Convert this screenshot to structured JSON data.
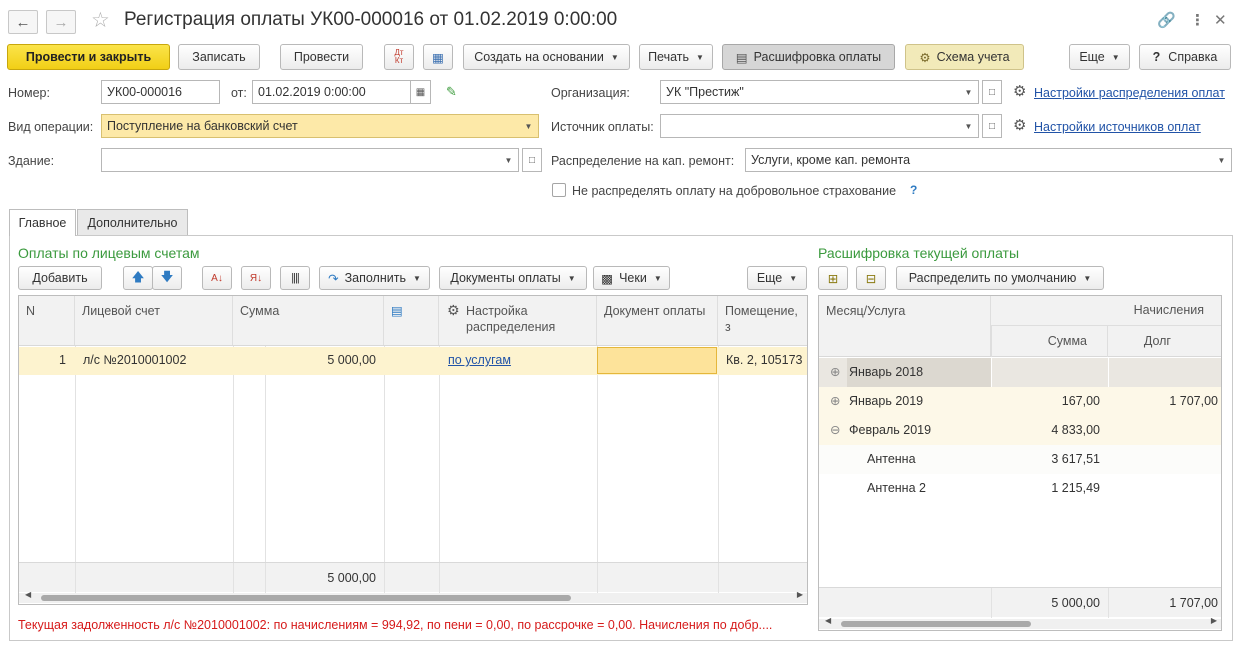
{
  "window": {
    "title": "Регистрация оплаты УК00-000016 от 01.02.2019 0:00:00"
  },
  "toolbar": {
    "post_close": "Провести и закрыть",
    "save": "Записать",
    "post": "Провести",
    "create_based": "Создать на основании",
    "print": "Печать",
    "payment_breakdown": "Расшифровка оплаты",
    "accounting_scheme": "Схема учета",
    "more": "Еще",
    "help": "Справка",
    "dt_kt": "Дт Кт"
  },
  "form": {
    "number_label": "Номер:",
    "number_value": "УК00-000016",
    "date_label": "от:",
    "date_value": "01.02.2019  0:00:00",
    "operation_label": "Вид операции:",
    "operation_value": "Поступление на банковский счет",
    "building_label": "Здание:",
    "building_value": "",
    "org_label": "Организация:",
    "org_value": "УК \"Престиж\"",
    "source_label": "Источник оплаты:",
    "source_value": "",
    "distribution_label": "Распределение на кап. ремонт:",
    "distribution_value": "Услуги, кроме кап. ремонта",
    "no_insurance_label": "Не распределять оплату на добровольное страхование",
    "no_insurance_checked": false,
    "link_distribution_settings": "Настройки распределения оплат",
    "link_source_settings": "Настройки источников оплат"
  },
  "tabs": [
    {
      "label": "Главное",
      "active": true
    },
    {
      "label": "Дополнительно",
      "active": false
    }
  ],
  "left": {
    "title": "Оплаты по лицевым счетам",
    "buttons": {
      "add": "Добавить",
      "fill": "Заполнить",
      "payment_docs": "Документы оплаты",
      "checks": "Чеки",
      "more": "Еще"
    },
    "columns": [
      "N",
      "Лицевой счет",
      "Сумма",
      "",
      "Настройка распределения",
      "Документ оплаты",
      "Помещение, з"
    ],
    "rows": [
      {
        "n": "1",
        "account": "л/с №2010001002",
        "sum": "5 000,00",
        "setting": "по услугам",
        "document": "",
        "premises": "Кв. 2, 105173"
      }
    ],
    "footer_sum": "5 000,00"
  },
  "right": {
    "title": "Расшифровка текущей оплаты",
    "buttons": {
      "distribute_default": "Распределить по умолчанию"
    },
    "columns": {
      "month_service": "Месяц/Услуга",
      "accruals": "Начисления",
      "sum": "Сумма",
      "debt": "Долг"
    },
    "rows": [
      {
        "label": "Январь 2018",
        "sum": "",
        "debt": "",
        "expander": "⊕",
        "level": 0
      },
      {
        "label": "Январь 2019",
        "sum": "167,00",
        "debt": "1 707,00",
        "expander": "⊕",
        "level": 0
      },
      {
        "label": "Февраль 2019",
        "sum": "4 833,00",
        "debt": "",
        "expander": "⊖",
        "level": 0
      },
      {
        "label": "Антенна",
        "sum": "3 617,51",
        "debt": "",
        "expander": "",
        "level": 1
      },
      {
        "label": "Антенна 2",
        "sum": "1 215,49",
        "debt": "",
        "expander": "",
        "level": 1
      }
    ],
    "footer_sum": "5 000,00",
    "footer_debt": "1 707,00"
  },
  "status": {
    "debt_message": "Текущая задолженность л/с №2010001002: по начислениям = 994,92, по пени = 0,00, по рассрочке = 0,00. Начисления по добр...."
  },
  "colors": {
    "primary_button": "#f5d522",
    "section_title": "#3b9a3e",
    "link": "#2153a7",
    "warning": "#d61a1a",
    "selected_row": "#fdf3cf"
  }
}
